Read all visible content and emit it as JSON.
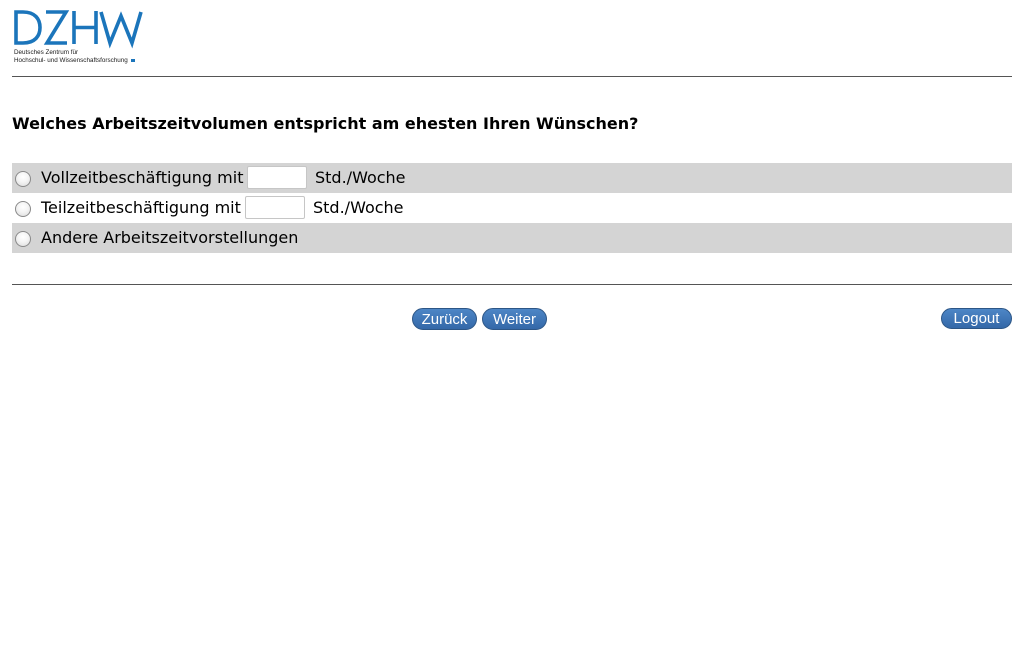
{
  "logo": {
    "wordmark": "DZHW",
    "subtitle_line1": "Deutsches Zentrum für",
    "subtitle_line2": "Hochschul- und Wissenschaftsforschung",
    "brand_color": "#1b75bb"
  },
  "question": "Welches Arbeitszeitvolumen entspricht am ehesten Ihren Wünschen?",
  "options": [
    {
      "label": "Vollzeitbeschäftigung mit",
      "hours_value": "",
      "unit": "Std./Woche",
      "selected": false
    },
    {
      "label": "Teilzeitbeschäftigung mit",
      "hours_value": "",
      "unit": "Std./Woche",
      "selected": false
    },
    {
      "label": "Andere Arbeitszeitvorstellungen",
      "selected": false
    }
  ],
  "nav": {
    "back_label": "Zurück",
    "next_label": "Weiter",
    "logout_label": "Logout"
  },
  "colors": {
    "button_blue": "#3b72b4",
    "row_shade": "#d4d4d4",
    "rule": "#555555"
  }
}
